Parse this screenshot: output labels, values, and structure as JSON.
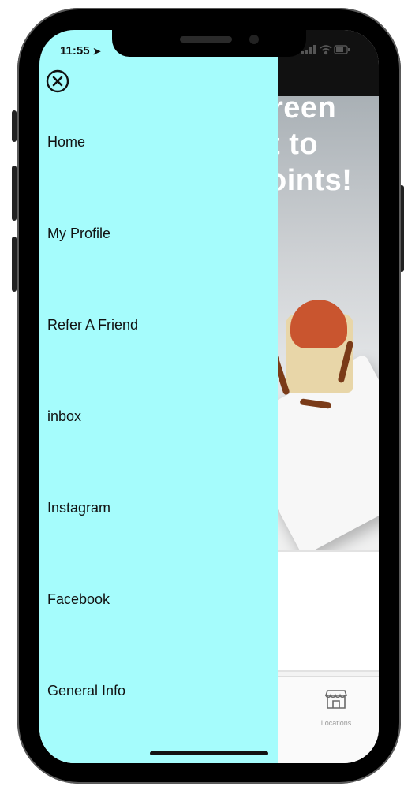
{
  "status_bar": {
    "time": "11:55"
  },
  "hero": {
    "line1": "reen",
    "line2": "t to",
    "line3": "oints!"
  },
  "drawer": {
    "items": [
      {
        "label": "Home"
      },
      {
        "label": "My Profile"
      },
      {
        "label": "Refer A Friend"
      },
      {
        "label": "inbox"
      },
      {
        "label": "Instagram"
      },
      {
        "label": "Facebook"
      },
      {
        "label": "General Info"
      }
    ]
  },
  "tabbar": {
    "locations_label": "Locations"
  },
  "colors": {
    "drawer_bg": "#a5fcfc",
    "accent": "#111111"
  },
  "icons": {
    "close": "close-icon",
    "location": "storefront-icon",
    "arrow": "location-arrow-icon"
  }
}
